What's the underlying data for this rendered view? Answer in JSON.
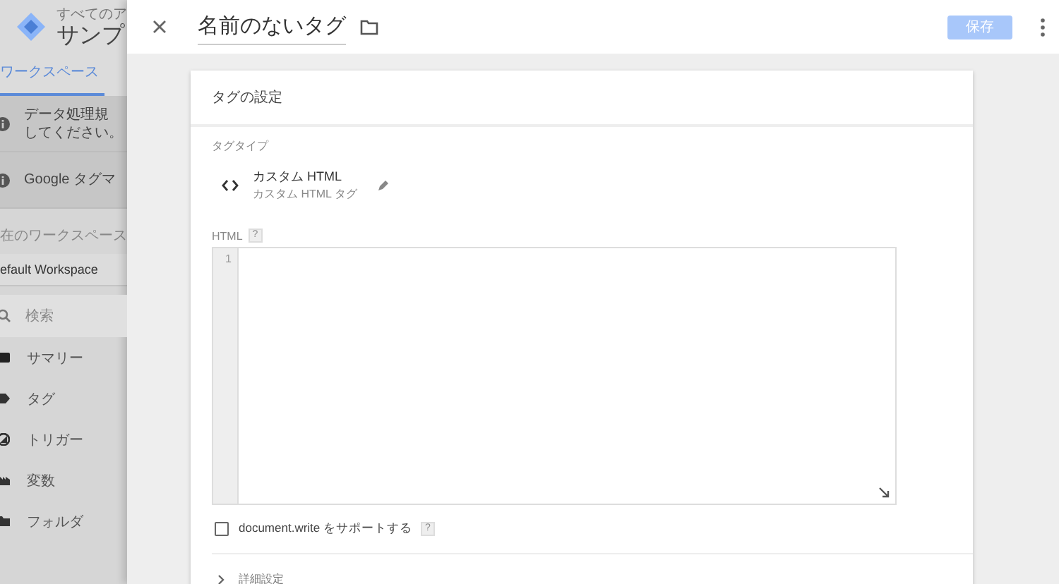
{
  "sidebar": {
    "breadcrumb": "すべてのア",
    "title": "サンプ",
    "tabs": [
      {
        "label": "ワークスペース",
        "selected": true
      }
    ],
    "notices": [
      {
        "lines": [
          "データ処理規",
          "してください。"
        ]
      },
      {
        "lines": [
          "Google タグマ"
        ]
      }
    ],
    "workspace": {
      "label": "在のワークスペース",
      "value": "efault Workspace"
    },
    "search": {
      "placeholder": "検索"
    },
    "nav": [
      {
        "label": "サマリー",
        "kind": "summary"
      },
      {
        "label": "タグ",
        "kind": "tag"
      },
      {
        "label": "トリガー",
        "kind": "trigger"
      },
      {
        "label": "変数",
        "kind": "variable"
      },
      {
        "label": "フォルダ",
        "kind": "folder"
      }
    ]
  },
  "panel": {
    "title": "名前のないタグ",
    "save_button": {
      "label": "保存",
      "disabled": true
    },
    "card": {
      "title": "タグの設定",
      "tag_type_label": "タグタイプ",
      "tag_type": {
        "name": "カスタム HTML",
        "description": "カスタム HTML タグ"
      },
      "html_label": "HTML",
      "html_help": "?",
      "editor": {
        "line_numbers": [
          "1"
        ]
      },
      "document_write": {
        "label": "document.write をサポートする",
        "checked": false,
        "help": "?"
      },
      "advanced": {
        "label": "詳細設定",
        "expanded": false
      }
    }
  }
}
